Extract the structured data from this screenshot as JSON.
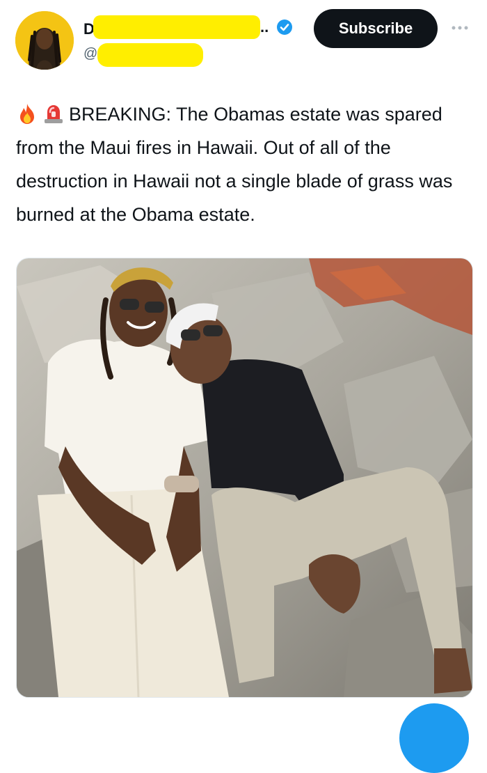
{
  "author": {
    "name_visible_initial": "D",
    "name_trailing": "..",
    "handle_prefix": "@",
    "verified": true,
    "avatar_icon": "avatar-portrait"
  },
  "actions": {
    "subscribe_label": "Subscribe",
    "more_icon": "more-dots-icon"
  },
  "post": {
    "emojis": [
      "fire-icon",
      "siren-icon"
    ],
    "text": "BREAKING: The Obamas estate was spared from the Maui fires in Hawaii. Out of all of the destruction in Hawaii not a single blade of grass was burned at the Obama estate."
  },
  "media": {
    "type": "photo"
  },
  "colors": {
    "redaction": "#ffee00",
    "verified": "#1d9bf0",
    "button_bg": "#0f1419",
    "fab": "#1d9bf0"
  }
}
